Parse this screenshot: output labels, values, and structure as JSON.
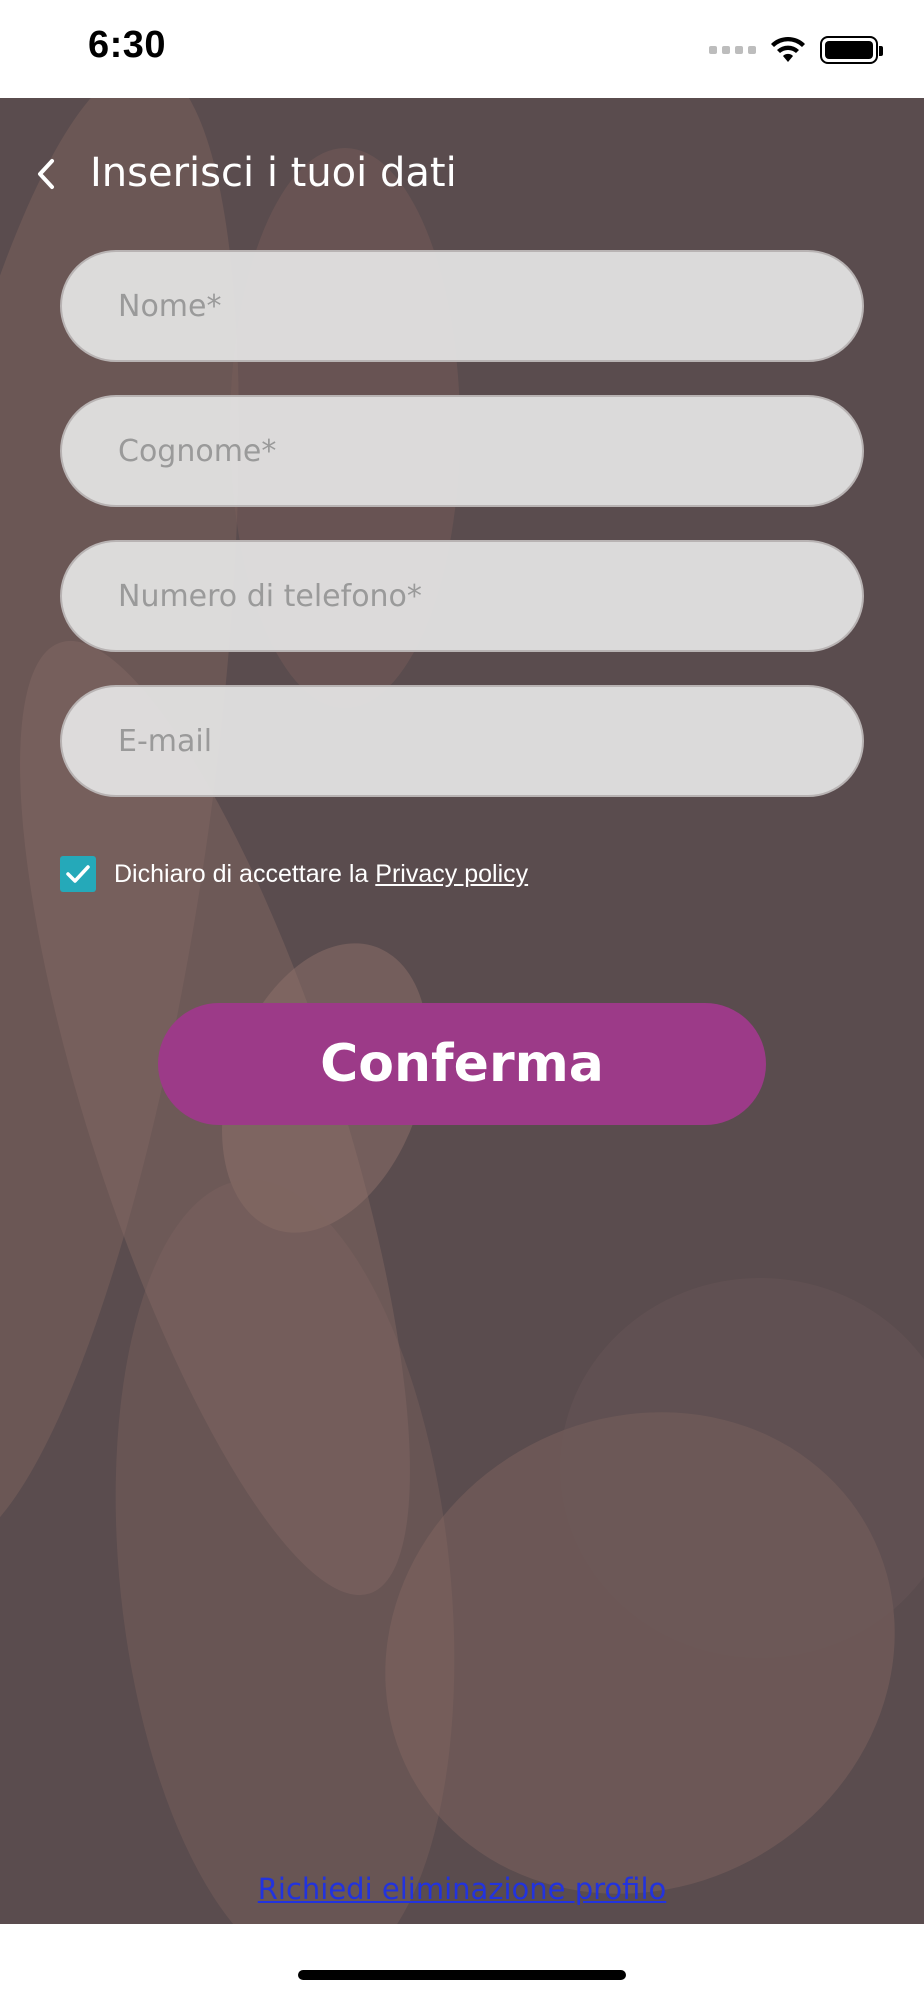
{
  "status_bar": {
    "time": "6:30",
    "icons": [
      "signal-icon",
      "wifi-icon",
      "battery-icon"
    ]
  },
  "header": {
    "title": "Inserisci i tuoi dati",
    "back_icon": "chevron-left-icon"
  },
  "form": {
    "fields": [
      {
        "placeholder": "Nome*",
        "value": ""
      },
      {
        "placeholder": "Cognome*",
        "value": ""
      },
      {
        "placeholder": "Numero di telefono*",
        "value": ""
      },
      {
        "placeholder": "E-mail",
        "value": ""
      }
    ],
    "consent": {
      "checked": true,
      "text": "Dichiaro di accettare la",
      "link": "Privacy policy"
    },
    "confirm_label": "Conferma"
  },
  "footer": {
    "delete_link": "Richiedi eliminazione profilo"
  },
  "colors": {
    "accent": "#9c3a88",
    "checkbox": "#25a9b9",
    "background_tint": "#5f5153",
    "link": "#2233dd"
  }
}
